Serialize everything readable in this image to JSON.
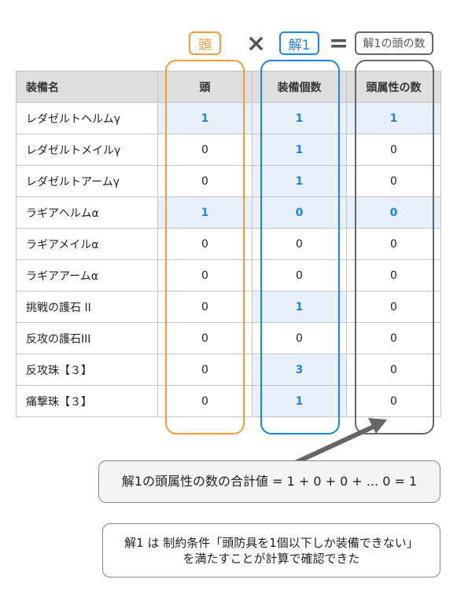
{
  "labels": {
    "head": "頭",
    "solution": "解1",
    "result": "解1の頭の数",
    "times": "×",
    "equals": "="
  },
  "colors": {
    "orange": "#f89c3a",
    "blue": "#1a84f0",
    "gray": "#666666",
    "highlight": "#e8f0fb"
  },
  "table": {
    "headers": [
      "装備名",
      "頭",
      "装備個数",
      "頭属性の数"
    ],
    "rows": [
      [
        "レダゼルトヘルムγ",
        "1",
        "1",
        "1"
      ],
      [
        "レダゼルトメイルγ",
        "0",
        "1",
        "0"
      ],
      [
        "レダゼルトアームγ",
        "0",
        "1",
        "0"
      ],
      [
        "ラギアヘルムα",
        "1",
        "0",
        "0"
      ],
      [
        "ラギアメイルα",
        "0",
        "0",
        "0"
      ],
      [
        "ラギアアームα",
        "0",
        "0",
        "0"
      ],
      [
        "挑戦の護石 II",
        "0",
        "1",
        "0"
      ],
      [
        "反攻の護石III",
        "0",
        "0",
        "0"
      ],
      [
        "反攻珠【３】",
        "0",
        "3",
        "0"
      ],
      [
        "痛撃珠【３】",
        "0",
        "1",
        "0"
      ]
    ]
  },
  "notes": {
    "sum": "解1の頭属性の数の合計値 = 1 + 0 + 0 + ... 0 = 1",
    "conclusion_line1": "解1 は 制約条件「頭防具を1個以下しか装備できない」",
    "conclusion_line2": "を満たすことが計算で確認できた"
  }
}
